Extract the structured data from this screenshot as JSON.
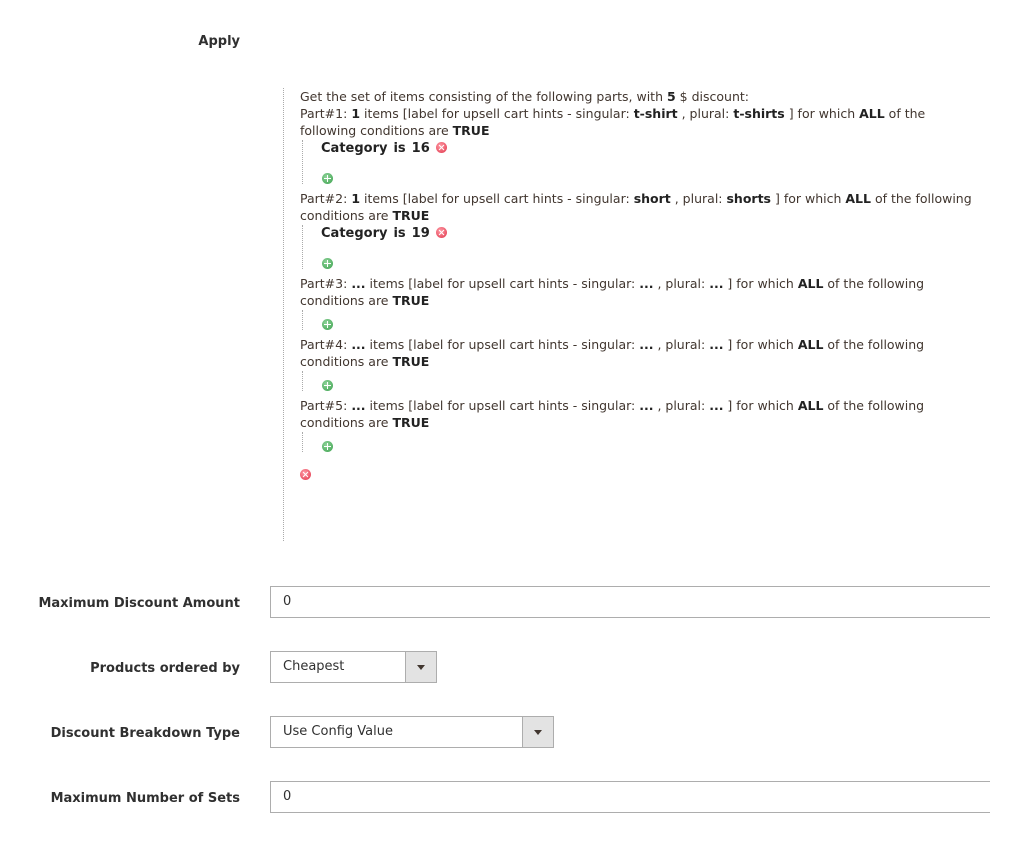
{
  "apply": {
    "label": "Apply"
  },
  "rule": {
    "intro": {
      "prefix": "Get the set of items consisting of the following parts, with ",
      "amount": "5",
      "suffix": " $ discount:"
    },
    "parts": [
      {
        "title": "Part#1:",
        "qty": "1",
        "text_a": " items [label for upsell cart hints - singular: ",
        "singular": "t-shirt",
        "text_b": " , plural: ",
        "plural": "t-shirts",
        "text_c": " ] for which ",
        "aggregator": "ALL",
        "text_d": " of the following conditions are ",
        "value": "TRUE",
        "conditions": [
          {
            "attribute": "Category",
            "operator": "is",
            "value": "16"
          }
        ]
      },
      {
        "title": "Part#2:",
        "qty": "1",
        "text_a": " items [label for upsell cart hints - singular: ",
        "singular": "short",
        "text_b": " , plural: ",
        "plural": "shorts",
        "text_c": " ] for which ",
        "aggregator": "ALL",
        "text_d": " of the following conditions are ",
        "value": "TRUE",
        "conditions": [
          {
            "attribute": "Category",
            "operator": "is",
            "value": "19"
          }
        ]
      },
      {
        "title": "Part#3:",
        "qty": "...",
        "text_a": " items [label for upsell cart hints - singular: ",
        "singular": "...",
        "text_b": " , plural: ",
        "plural": "...",
        "text_c": " ] for which ",
        "aggregator": "ALL",
        "text_d": " of the following conditions are ",
        "value": "TRUE",
        "conditions": []
      },
      {
        "title": "Part#4:",
        "qty": "...",
        "text_a": " items [label for upsell cart hints - singular: ",
        "singular": "...",
        "text_b": " , plural: ",
        "plural": "...",
        "text_c": " ] for which ",
        "aggregator": "ALL",
        "text_d": " of the following conditions are ",
        "value": "TRUE",
        "conditions": []
      },
      {
        "title": "Part#5:",
        "qty": "...",
        "text_a": " items [label for upsell cart hints - singular: ",
        "singular": "...",
        "text_b": " , plural: ",
        "plural": "...",
        "text_c": " ] for which ",
        "aggregator": "ALL",
        "text_d": " of the following conditions are ",
        "value": "TRUE",
        "conditions": []
      }
    ]
  },
  "fields": {
    "max_discount": {
      "label": "Maximum Discount Amount",
      "value": "0"
    },
    "products_ordered_by": {
      "label": "Products ordered by",
      "value": "Cheapest"
    },
    "discount_breakdown": {
      "label": "Discount Breakdown Type",
      "value": "Use Config Value"
    },
    "max_sets": {
      "label": "Maximum Number of Sets",
      "value": "0"
    }
  },
  "icons": {
    "add": "add-circle-icon",
    "remove": "remove-circle-icon"
  },
  "colors": {
    "add": "#3aa04c",
    "remove": "#e0344a",
    "border": "#adadad"
  }
}
